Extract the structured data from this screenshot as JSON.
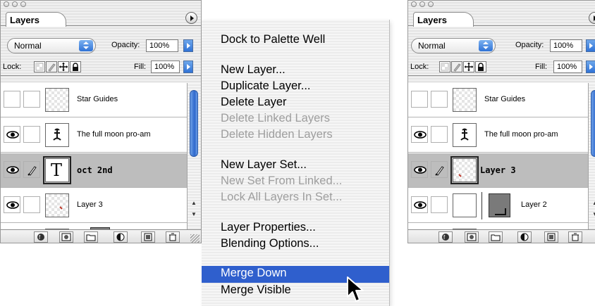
{
  "palette_left": {
    "tab_label": "Layers",
    "blend_mode": "Normal",
    "opacity_label": "Opacity:",
    "opacity_value": "100%",
    "lock_label": "Lock:",
    "fill_label": "Fill:",
    "fill_value": "100%",
    "layers": [
      {
        "name": "Star Guides",
        "visible": false,
        "linked": false,
        "thumb": "transparent",
        "selected": false
      },
      {
        "name": "The full moon pro-am",
        "visible": true,
        "linked": false,
        "thumb": "figure",
        "selected": false
      },
      {
        "name": "oct 2nd",
        "visible": true,
        "linked": true,
        "thumb": "text",
        "thumb_text": "T",
        "selected": true
      },
      {
        "name": "Layer 3",
        "visible": true,
        "linked": false,
        "thumb": "transparent",
        "selected": false
      }
    ]
  },
  "palette_right": {
    "tab_label": "Layers",
    "blend_mode": "Normal",
    "opacity_label": "Opacity:",
    "opacity_value": "100%",
    "lock_label": "Lock:",
    "fill_label": "Fill:",
    "fill_value": "100%",
    "layers": [
      {
        "name": "Star Guides",
        "visible": false,
        "linked": false,
        "thumb": "transparent",
        "selected": false
      },
      {
        "name": "The full moon pro-am",
        "visible": true,
        "linked": false,
        "thumb": "figure",
        "selected": false
      },
      {
        "name": "Layer 3",
        "visible": true,
        "linked": true,
        "thumb": "transparent",
        "selected": true
      },
      {
        "name": "Layer 2",
        "visible": true,
        "linked": false,
        "thumb": "mask",
        "selected": false
      }
    ]
  },
  "menu": {
    "items": [
      {
        "label": "Dock to Palette Well",
        "enabled": true
      },
      {
        "label": "New Layer...",
        "enabled": true
      },
      {
        "label": "Duplicate Layer...",
        "enabled": true
      },
      {
        "label": "Delete Layer",
        "enabled": true
      },
      {
        "label": "Delete Linked Layers",
        "enabled": false
      },
      {
        "label": "Delete Hidden Layers",
        "enabled": false
      },
      {
        "label": "New Layer Set...",
        "enabled": true
      },
      {
        "label": "New Set From Linked...",
        "enabled": false
      },
      {
        "label": "Lock All Layers In Set...",
        "enabled": false
      },
      {
        "label": "Layer Properties...",
        "enabled": true
      },
      {
        "label": "Blending Options...",
        "enabled": true
      },
      {
        "label": "Merge Down",
        "enabled": true,
        "highlighted": true
      },
      {
        "label": "Merge Visible",
        "enabled": true
      }
    ]
  },
  "colors": {
    "highlight": "#2f5fcd",
    "selected_row": "#bdbdbd",
    "accent_blue": "#2f72d6"
  },
  "icons": [
    "eye-icon",
    "brush-link-icon",
    "transparency-lock-icon",
    "paint-lock-icon",
    "move-lock-icon",
    "all-lock-icon",
    "palette-menu-icon",
    "layer-style-icon",
    "mask-icon",
    "folder-icon",
    "adjustment-icon",
    "new-layer-icon",
    "trash-icon",
    "arrow-cursor-icon"
  ]
}
